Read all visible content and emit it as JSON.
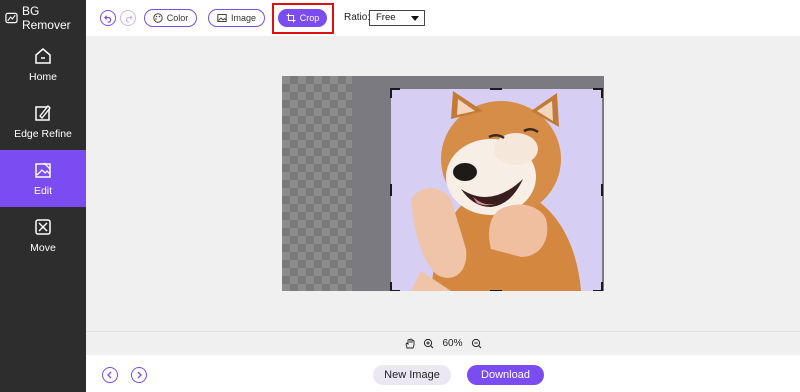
{
  "app": {
    "title": "BG Remover",
    "logo_icon": "app-logo-icon"
  },
  "sidebar": {
    "items": [
      {
        "label": "Home",
        "icon": "home-icon",
        "active": false
      },
      {
        "label": "Edge Refine",
        "icon": "edge-refine-icon",
        "active": false
      },
      {
        "label": "Edit",
        "icon": "edit-icon",
        "active": true
      },
      {
        "label": "Move",
        "icon": "move-icon",
        "active": false
      }
    ]
  },
  "toolbar": {
    "undo_icon": "undo-icon",
    "redo_icon": "redo-icon",
    "color_label": "Color",
    "image_label": "Image",
    "crop_label": "Crop",
    "ratio_label": "Ratio:",
    "ratio_value": "Free"
  },
  "zoom": {
    "hand_icon": "hand-icon",
    "zoom_in_icon": "zoom-in-icon",
    "zoom_out_icon": "zoom-out-icon",
    "level": "60%"
  },
  "bottom": {
    "new_image_label": "New Image",
    "download_label": "Download"
  },
  "colors": {
    "accent": "#7a4cf2",
    "sidebar_bg": "#2d2d2d",
    "highlight": "#e01010"
  }
}
